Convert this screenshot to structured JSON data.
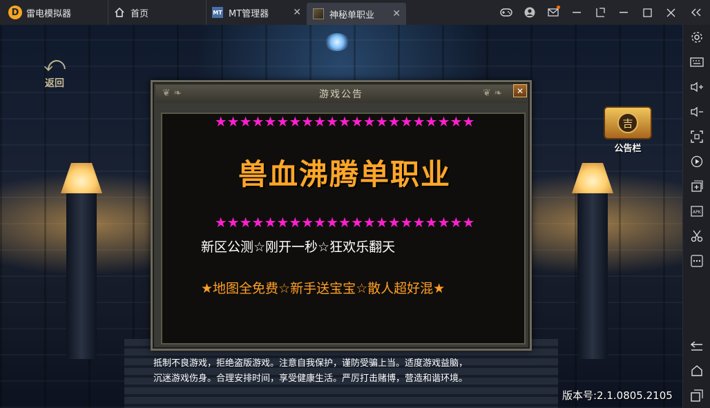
{
  "app": {
    "name": "雷电模拟器",
    "logo_glyph": "D"
  },
  "tabs": [
    {
      "label": "首页",
      "icon": "home-icon"
    },
    {
      "label": "MT管理器",
      "icon": "mt-manager-icon",
      "thumb_text": "MT"
    },
    {
      "label": "神秘单职业",
      "icon": "game-thumbnail-icon",
      "active": true
    }
  ],
  "window_controls": [
    "gamepad-icon",
    "account-icon",
    "mail-icon",
    "pin-icon",
    "restore-icon",
    "minimize-icon",
    "maximize-icon",
    "close-icon",
    "collapse-sidebar-icon"
  ],
  "sidebar": [
    "settings-icon",
    "keyboard-icon",
    "volume-up-icon",
    "volume-down-icon",
    "screenshot-icon",
    "record-icon",
    "add-apk-icon",
    "apk-install-icon",
    "cut-icon",
    "more-icon",
    "back-icon",
    "home-icon",
    "recent-apps-icon"
  ],
  "game": {
    "back_label": "返回",
    "notice_board_label": "公告栏",
    "notice_board_seal": "吉",
    "dialog": {
      "title": "游戏公告",
      "close_glyph": "✕",
      "stars_top": "★★★★★★★★★★★★★★★★★★★★★",
      "headline": "兽血沸腾单职业",
      "stars_bottom": "★★★★★★★★★★★★★★★★★★★★★",
      "line1": "新区公测☆刚开一秒☆狂欢乐翻天",
      "line2": "★地图全免费☆新手送宝宝☆散人超好混★"
    },
    "disclaimer_line1": "抵制不良游戏，拒绝盗版游戏。注意自我保护，谨防受骗上当。适度游戏益脑，",
    "disclaimer_line2": "沉迷游戏伤身。合理安排时间，享受健康生活。严厉打击赌博，营造和谐环境。",
    "version": "版本号:2.1.0805.2105"
  },
  "colors": {
    "stars": "#ff1fd0",
    "headline": "#ffa629",
    "line2": "#ff9f26"
  }
}
